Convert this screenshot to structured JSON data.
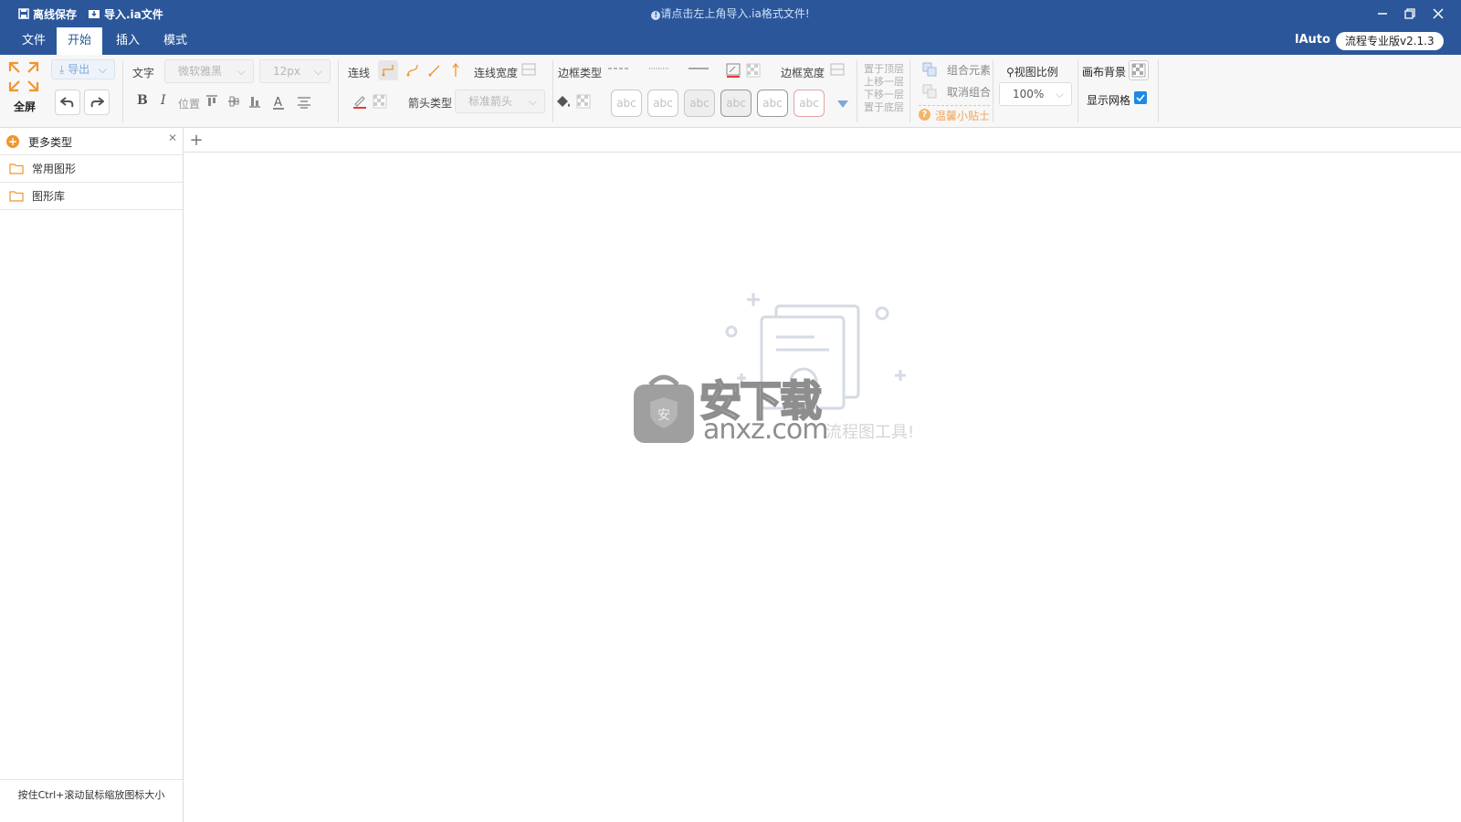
{
  "titlebar": {
    "offline_save": "离线保存",
    "import_ia": "导入.ia文件",
    "notice": "请点击左上角导入.ia格式文件!",
    "user": "lAuto",
    "version": "流程专业版v2.1.3"
  },
  "menu": [
    "文件",
    "开始",
    "插入",
    "模式"
  ],
  "toolbar": {
    "fullscreen": "全屏",
    "export": "导出",
    "text_label": "文字",
    "font_family": "微软雅黑",
    "font_size": "12px",
    "position": "位置",
    "line_label": "连线",
    "line_width": "连线宽度",
    "arrow_type_label": "箭头类型",
    "arrow_type": "标准箭头",
    "border_type": "边框类型",
    "border_width": "边框宽度",
    "abc": "abc",
    "layer": [
      "置于顶层",
      "上移一层",
      "下移一层",
      "置于底层"
    ],
    "group": "组合元素",
    "ungroup": "取消组合",
    "tips": "温馨小贴士",
    "zoom_label": "视图比例",
    "zoom_value": "100%",
    "canvas_bg": "画布背景",
    "show_grid": "显示网格"
  },
  "sidebar": {
    "more_types": "更多类型",
    "items": [
      "常用图形",
      "图形库"
    ],
    "hint": "按住Ctrl+滚动鼠标缩放图标大小"
  },
  "watermark": {
    "brand": "安下载",
    "domain": "anxz.com",
    "caption": "流程图工具!"
  },
  "colors": {
    "titlebar": "#2b579a",
    "accent_orange": "#f0952f",
    "check_blue": "#1e88e5"
  }
}
